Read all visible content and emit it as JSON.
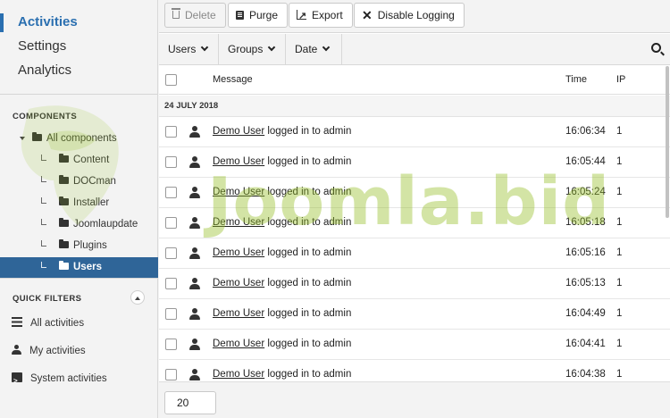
{
  "nav": {
    "items": [
      {
        "label": "Activities",
        "active": true
      },
      {
        "label": "Settings",
        "active": false
      },
      {
        "label": "Analytics",
        "active": false
      }
    ]
  },
  "components": {
    "title": "COMPONENTS",
    "root": "All components",
    "children": [
      "Content",
      "DOCman",
      "Installer",
      "Joomlaupdate",
      "Plugins",
      "Users"
    ],
    "selected": "Users"
  },
  "quick_filters": {
    "title": "QUICK FILTERS",
    "items": [
      {
        "label": "All activities",
        "icon": "list-icon"
      },
      {
        "label": "My activities",
        "icon": "user-icon"
      },
      {
        "label": "System activities",
        "icon": "terminal-icon"
      }
    ]
  },
  "toolbar": {
    "delete": "Delete",
    "purge": "Purge",
    "export": "Export",
    "disable_logging": "Disable Logging"
  },
  "filters": {
    "users": "Users",
    "groups": "Groups",
    "date": "Date"
  },
  "table": {
    "headers": {
      "message": "Message",
      "time": "Time",
      "ip": "IP"
    },
    "date_group": "24 JULY 2018",
    "rows": [
      {
        "user": "Demo User",
        "action": "logged in to admin",
        "time": "16:06:34",
        "ip": "1"
      },
      {
        "user": "Demo User",
        "action": "logged in to admin",
        "time": "16:05:44",
        "ip": "1"
      },
      {
        "user": "Demo User",
        "action": "logged in to admin",
        "time": "16:05:24",
        "ip": "1"
      },
      {
        "user": "Demo User",
        "action": "logged in to admin",
        "time": "16:05:18",
        "ip": "1"
      },
      {
        "user": "Demo User",
        "action": "logged in to admin",
        "time": "16:05:16",
        "ip": "1"
      },
      {
        "user": "Demo User",
        "action": "logged in to admin",
        "time": "16:05:13",
        "ip": "1"
      },
      {
        "user": "Demo User",
        "action": "logged in to admin",
        "time": "16:04:49",
        "ip": "1"
      },
      {
        "user": "Demo User",
        "action": "logged in to admin",
        "time": "16:04:41",
        "ip": "1"
      },
      {
        "user": "Demo User",
        "action": "logged in to admin",
        "time": "16:04:38",
        "ip": "1"
      }
    ]
  },
  "pagination": {
    "limit": "20"
  },
  "watermark": {
    "text": "Joomla.bid",
    "color": "#96be28"
  },
  "colors": {
    "accent": "#2a6fb0",
    "selected_bg": "#2f6598"
  }
}
